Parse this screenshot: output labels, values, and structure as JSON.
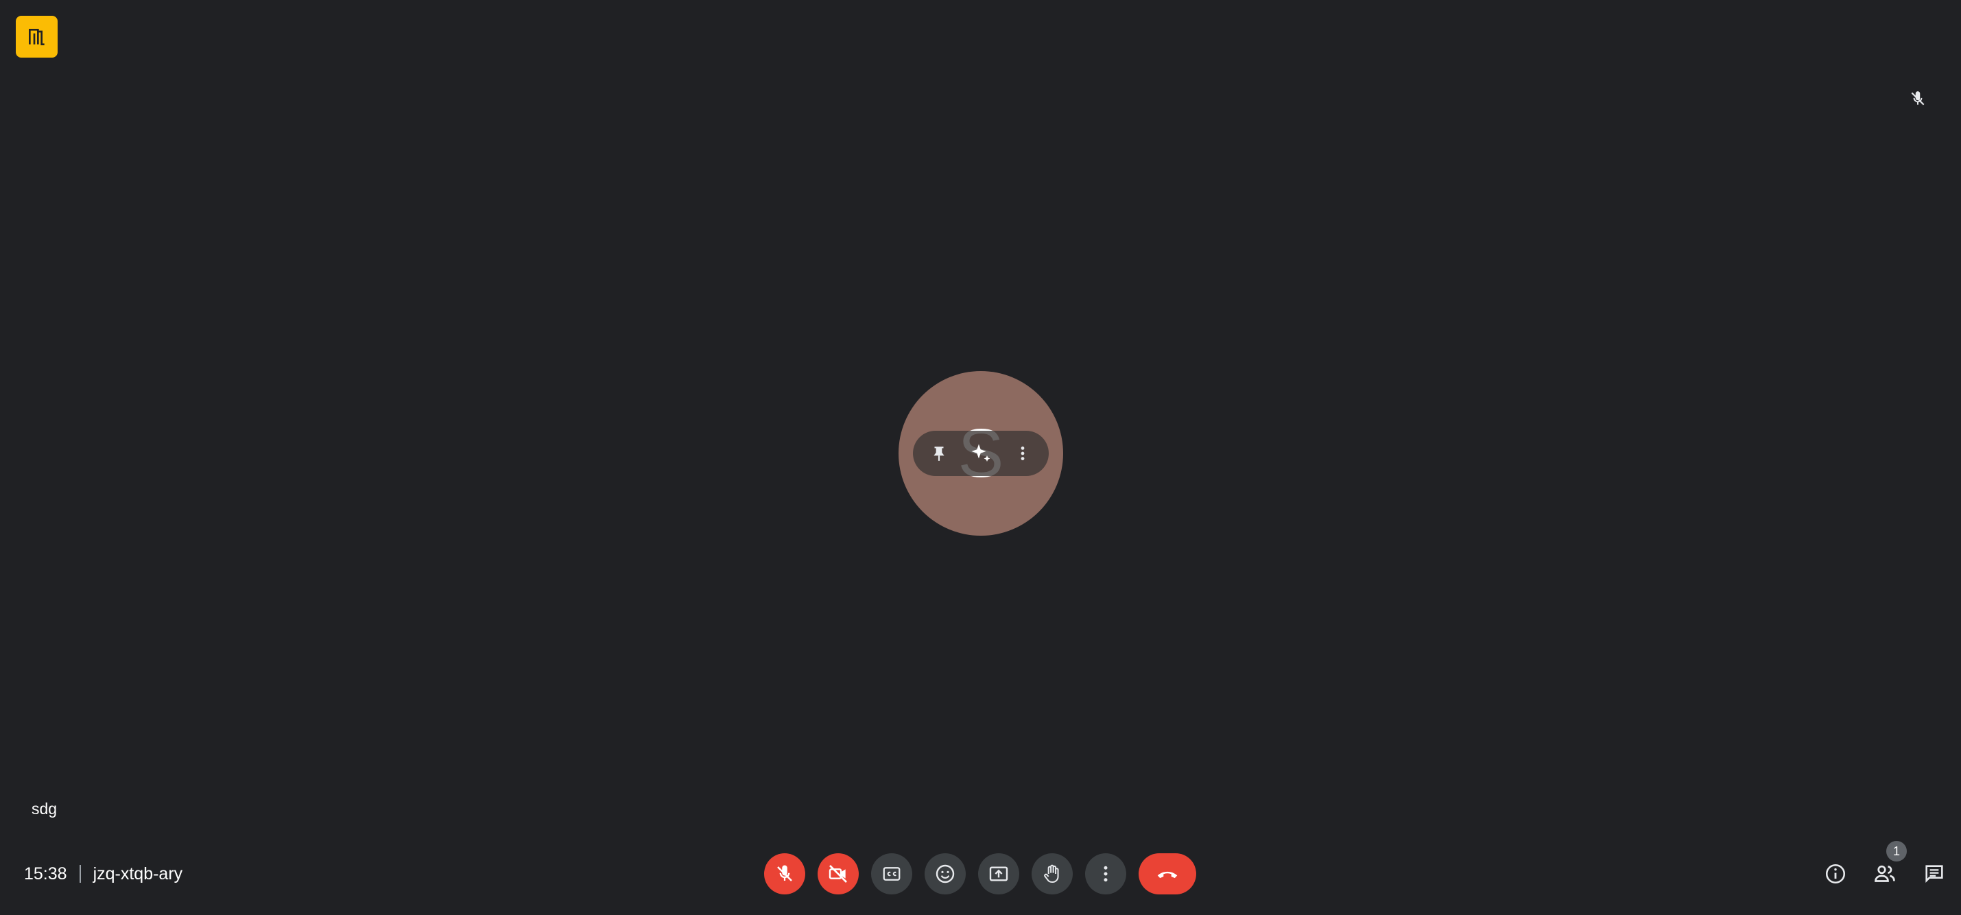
{
  "meeting": {
    "time": "15:38",
    "code": "jzq-xtqb-ary"
  },
  "participant": {
    "name": "sdg",
    "avatar_letter": "S",
    "avatar_color": "#8d6a60"
  },
  "controls": {
    "mic": {
      "icon": "mic-off-icon",
      "state": "off"
    },
    "camera": {
      "icon": "videocam-off-icon",
      "state": "off"
    },
    "captions": {
      "icon": "closed-caption-icon"
    },
    "reactions": {
      "icon": "emoji-icon"
    },
    "present": {
      "icon": "present-screen-icon"
    },
    "raise_hand": {
      "icon": "raise-hand-icon"
    },
    "more": {
      "icon": "more-vert-icon"
    },
    "leave": {
      "icon": "call-end-icon"
    }
  },
  "side_controls": {
    "info": {
      "icon": "info-icon"
    },
    "people": {
      "icon": "people-icon",
      "count": "1"
    },
    "chat": {
      "icon": "chat-icon"
    }
  },
  "colors": {
    "background": "#202124",
    "danger": "#ea4335",
    "control": "#3c4043",
    "logo": "#fbbc04"
  }
}
